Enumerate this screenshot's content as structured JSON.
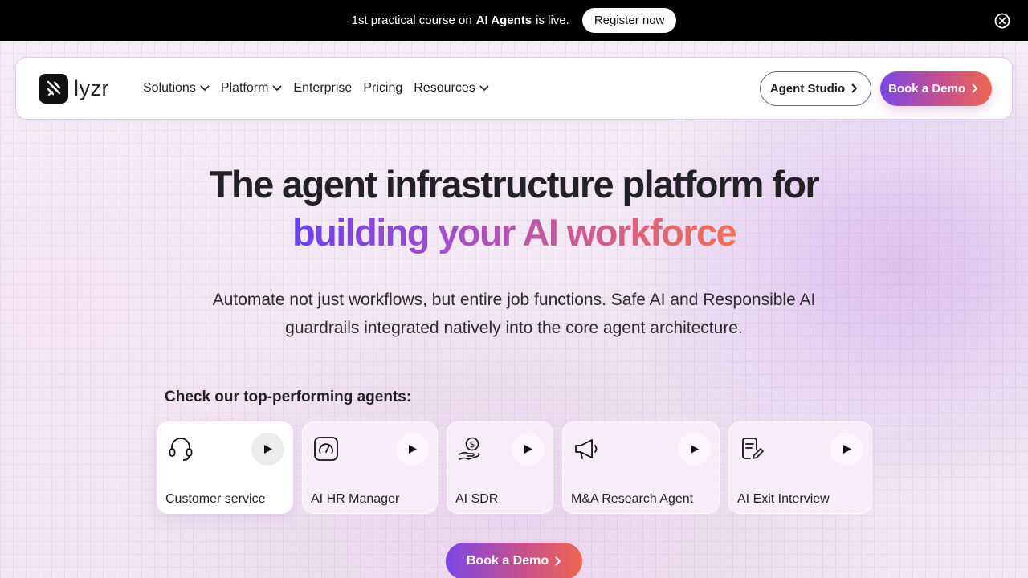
{
  "announcement": {
    "text_before": "1st practical course on",
    "text_bold": "AI Agents",
    "text_after": "is live.",
    "cta_label": "Register now"
  },
  "nav": {
    "logo_text": "lyzr",
    "menu": [
      {
        "label": "Solutions",
        "has_dropdown": true
      },
      {
        "label": "Platform",
        "has_dropdown": true
      },
      {
        "label": "Enterprise",
        "has_dropdown": false
      },
      {
        "label": "Pricing",
        "has_dropdown": false
      },
      {
        "label": "Resources",
        "has_dropdown": true
      }
    ],
    "studio_label": "Agent Studio",
    "demo_label": "Book a Demo"
  },
  "hero": {
    "title_line1": "The agent infrastructure platform for",
    "title_line2": "building your AI workforce",
    "subtitle_line1": "Automate not just workflows, but entire job functions. Safe AI and Responsible AI",
    "subtitle_line2": "guardrails integrated natively into the core agent architecture."
  },
  "agents": {
    "heading": "Check our top-performing agents:",
    "items": [
      {
        "label": "Customer service",
        "icon": "headset-icon",
        "active": true
      },
      {
        "label": "AI HR Manager",
        "icon": "gauge-icon",
        "active": false
      },
      {
        "label": "AI SDR",
        "icon": "money-hand-icon",
        "active": false
      },
      {
        "label": "M&A Research Agent",
        "icon": "megaphone-icon",
        "active": false
      },
      {
        "label": "AI Exit Interview",
        "icon": "document-edit-icon",
        "active": false
      }
    ]
  },
  "bottom_cta": {
    "label": "Book a Demo"
  },
  "colors": {
    "gradient_start": "#6a3ff0",
    "gradient_mid": "#c6508f",
    "gradient_end": "#f2704f",
    "announcement_bg": "#000000"
  }
}
